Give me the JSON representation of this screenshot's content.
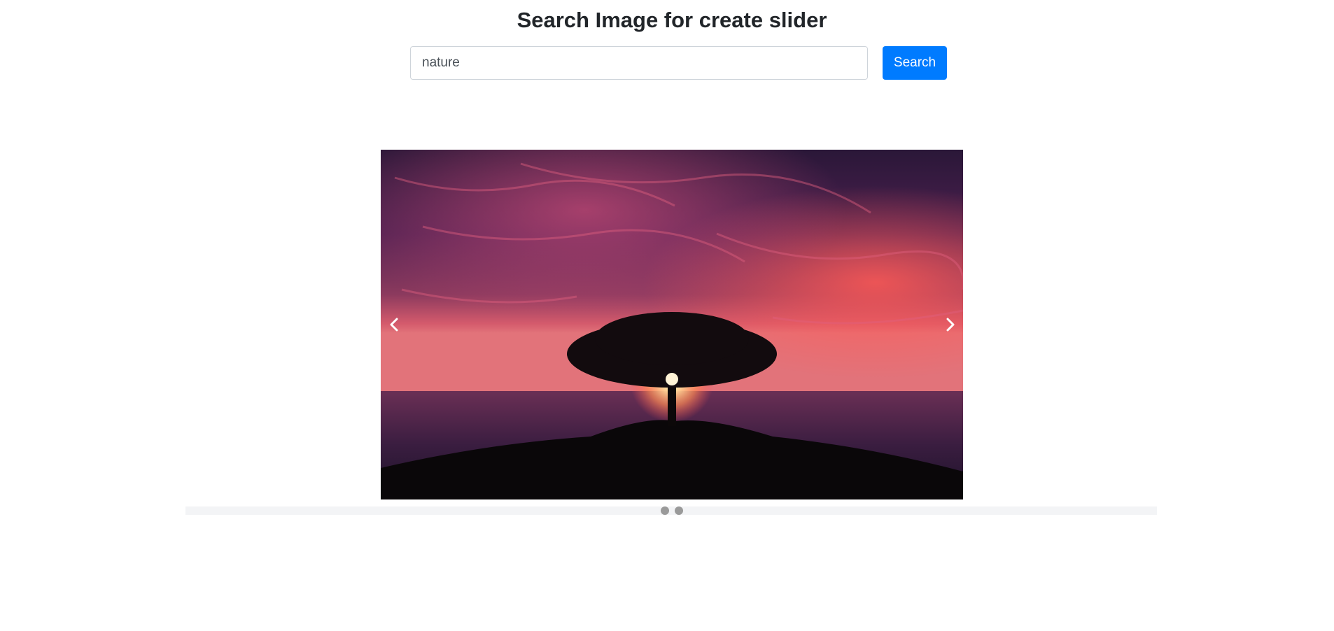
{
  "header": {
    "title": "Search Image for create slider"
  },
  "search": {
    "value": "nature",
    "button_label": "Search"
  },
  "slider": {
    "image_icon": "sunset-tree-photo",
    "prev_icon": "chevron-left-icon",
    "next_icon": "chevron-right-icon",
    "slide_count": 2,
    "active_slide": 1
  },
  "colors": {
    "primary": "#007bff",
    "indicator": "#9a9a9a",
    "indicator_bar": "#f3f4f6"
  }
}
